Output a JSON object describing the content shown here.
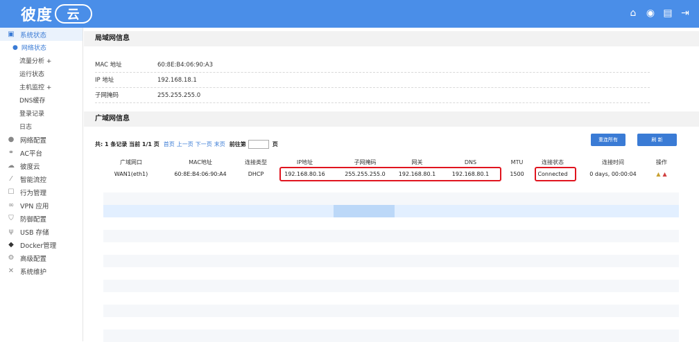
{
  "brand": {
    "logo_text": "彼度",
    "logo_cloud": "云"
  },
  "header": {
    "icons": [
      "home-icon",
      "play-circle-icon",
      "document-icon",
      "logout-icon"
    ]
  },
  "sidebar": {
    "items": [
      {
        "label": "系统状态",
        "icon": "monitor-icon",
        "active": true
      },
      {
        "label": "网络状态",
        "sub": true,
        "current": true
      },
      {
        "label": "流量分析 +",
        "sub": true
      },
      {
        "label": "运行状态",
        "sub": true
      },
      {
        "label": "主机监控 +",
        "sub": true
      },
      {
        "label": "DNS缓存",
        "sub": true
      },
      {
        "label": "登录记录",
        "sub": true
      },
      {
        "label": "日志",
        "sub": true
      },
      {
        "label": "网络配置",
        "icon": "globe-icon"
      },
      {
        "label": "AC平台",
        "icon": "network-tree-icon"
      },
      {
        "label": "彼度云",
        "icon": "cloud-icon"
      },
      {
        "label": "智能流控",
        "icon": "trend-icon"
      },
      {
        "label": "行为管理",
        "icon": "clipboard-icon"
      },
      {
        "label": "VPN 应用",
        "icon": "vpn-icon"
      },
      {
        "label": "防御配置",
        "icon": "shield-icon"
      },
      {
        "label": "USB 存储",
        "icon": "usb-icon"
      },
      {
        "label": "Docker管理",
        "icon": "docker-icon"
      },
      {
        "label": "高级配置",
        "icon": "gear-icon"
      },
      {
        "label": "系统维护",
        "icon": "tools-icon"
      }
    ]
  },
  "lan": {
    "title": "局域网信息",
    "rows": [
      {
        "key": "MAC 地址",
        "value": "60:8E:B4:06:90:A3"
      },
      {
        "key": "IP 地址",
        "value": "192.168.18.1"
      },
      {
        "key": "子网掩码",
        "value": "255.255.255.0"
      }
    ]
  },
  "wan": {
    "title": "广域网信息",
    "pager": {
      "summary": "共: 1 条记录 当前 1/1 页",
      "first": "首页",
      "prev": "上一页",
      "next": "下一页",
      "last": "末页",
      "goto": "前往第",
      "page_suffix": "页"
    },
    "reconnect_all": "重连所有",
    "refresh": "刷 新",
    "columns": [
      "广域网口",
      "MAC地址",
      "连接类型",
      "IP地址",
      "子网掩码",
      "网关",
      "DNS",
      "MTU",
      "连接状态",
      "连接时间",
      "操作"
    ],
    "rows": [
      {
        "iface": "WAN1(eth1)",
        "mac": "60:8E:B4:06:90:A4",
        "type": "DHCP",
        "ip": "192.168.80.16",
        "mask": "255.255.255.0",
        "gateway": "192.168.80.1",
        "dns": "192.168.80.1",
        "mtu": "1500",
        "status": "Connected",
        "uptime": "0 days, 00:00:04"
      }
    ]
  },
  "colors": {
    "header": "#4a8ee8",
    "accent": "#3a7bd5",
    "highlight": "#e0141e"
  }
}
